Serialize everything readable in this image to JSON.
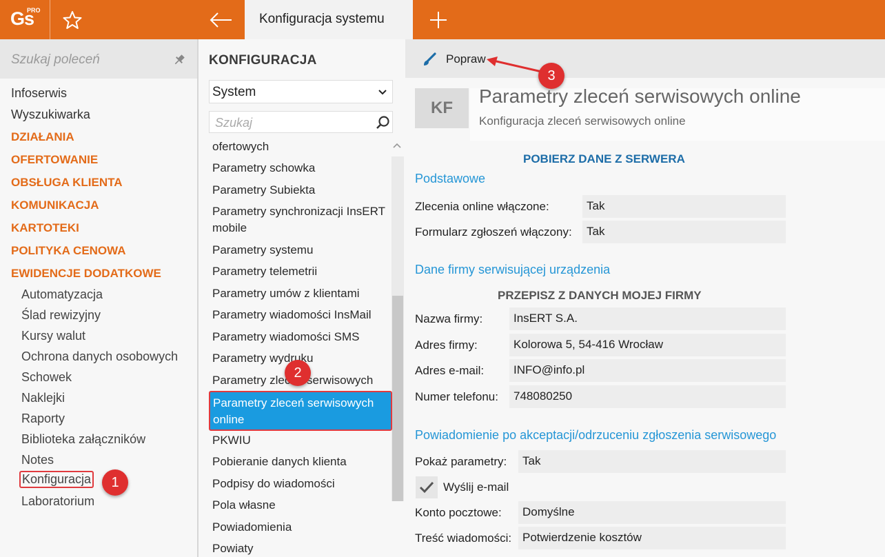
{
  "topbar": {
    "logo_text": "Gs",
    "logo_badge": "PRO",
    "active_tab": "Konfiguracja systemu",
    "icons": [
      "star-icon",
      "back-arrow-icon",
      "plus-icon"
    ],
    "accent": "#e36b19"
  },
  "leftnav": {
    "search_placeholder": "Szukaj poleceń",
    "items": [
      "Infoserwis",
      "Wyszukiwarka"
    ],
    "categories": [
      "DZIAŁANIA",
      "OFERTOWANIE",
      "OBSŁUGA KLIENTA",
      "KOMUNIKACJA",
      "KARTOTEKI",
      "POLITYKA CENOWA",
      "EWIDENCJE DODATKOWE"
    ],
    "subitems": [
      "Automatyzacja",
      "Ślad rewizyjny",
      "Kursy walut",
      "Ochrona danych osobowych",
      "Schowek",
      "Naklejki",
      "Raporty",
      "Biblioteka załączników",
      "Notes",
      "Konfiguracja",
      "Laboratorium"
    ]
  },
  "midcol": {
    "title": "KONFIGURACJA",
    "select_value": "System",
    "search_placeholder": "Szukaj",
    "list": [
      "ofertowych",
      "Parametry schowka",
      "Parametry Subiekta",
      "Parametry synchronizacji InsERT",
      "mobile",
      "Parametry systemu",
      "Parametry telemetrii",
      "Parametry umów z klientami",
      "Parametry wiadomości InsMail",
      "Parametry wiadomości SMS",
      "Parametry wydruku",
      "Parametry zleceń serwisowych",
      "PKWIU",
      "Pobieranie danych klienta",
      "Podpisy do wiadomości",
      "Pola własne",
      "Powiadomienia",
      "Powiaty"
    ],
    "active_item": "Parametry zleceń serwisowych online",
    "active_color": "#1a9be0"
  },
  "toolbar": {
    "edit_label": "Popraw"
  },
  "content": {
    "badge": "KF",
    "title": "Parametry zleceń serwisowych online",
    "subtitle": "Konfiguracja zleceń serwisowych online",
    "fetch_action": "POBIERZ DANE Z SERWERA",
    "sections": {
      "basic": "Podstawowe",
      "company": "Dane firmy serwisującej urządzenia",
      "notify": "Powiadomienie po akceptacji/odrzuceniu zgłoszenia serwisowego"
    },
    "copy_action": "PRZEPISZ Z DANYCH MOJEJ FIRMY",
    "fields": [
      {
        "label": "Zlecenia online włączone:",
        "value": "Tak"
      },
      {
        "label": "Formularz zgłoszeń włączony:",
        "value": "Tak"
      },
      {
        "label": "Nazwa firmy:",
        "value": "InsERT S.A."
      },
      {
        "label": "Adres firmy:",
        "value": "Kolorowa 5, 54-416 Wrocław"
      },
      {
        "label": "Adres e-mail:",
        "value": "INFO@info.pl"
      },
      {
        "label": "Numer telefonu:",
        "value": "748080250"
      },
      {
        "label": "Pokaż parametry:",
        "value": "Tak"
      },
      {
        "label": "Konto pocztowe:",
        "value": "Domyślne"
      },
      {
        "label": "Treść wiadomości:",
        "value": "Potwierdzenie kosztów"
      }
    ],
    "send_email_label": "Wyślij e-mail",
    "send_email_checked": true
  },
  "annotations": {
    "one": "1",
    "two": "2",
    "three": "3",
    "color": "#df2f2f"
  }
}
